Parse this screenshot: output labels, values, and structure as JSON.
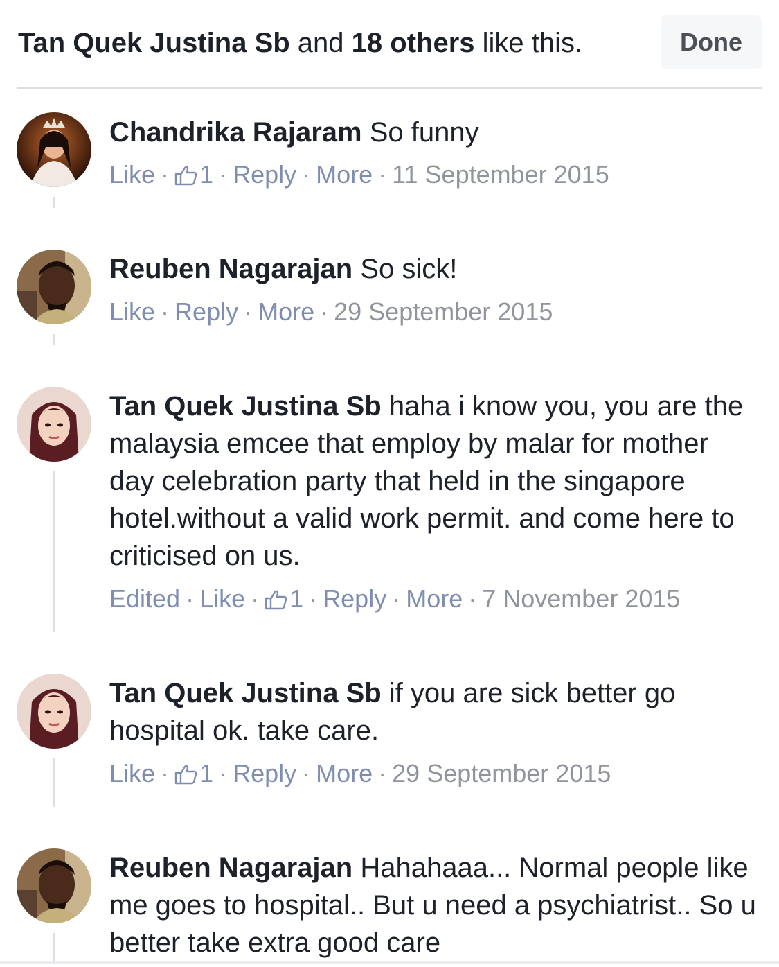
{
  "header": {
    "like_names": "Tan Quek Justina Sb",
    "like_and": " and ",
    "like_others": "18 others",
    "like_suffix": " like this.",
    "done_label": "Done"
  },
  "actions": {
    "like": "Like",
    "reply": "Reply",
    "more": "More",
    "edited": "Edited",
    "separator": "·"
  },
  "comments": [
    {
      "author": "Chandrika Rajaram",
      "text": "So funny",
      "reaction_count": "1",
      "date": "11 September 2015"
    },
    {
      "author": "Reuben Nagarajan",
      "text": "So sick!",
      "date": "29 September 2015"
    },
    {
      "author": "Tan Quek Justina Sb",
      "text": "haha i know you, you are the malaysia emcee that employ by malar for mother day celebration party that held in the singapore hotel.without a valid work permit. and come here to criticised on us.",
      "reaction_count": "1",
      "date": "7 November 2015"
    },
    {
      "author": "Tan Quek Justina Sb",
      "text": "if you are sick better go hospital ok. take care.",
      "reaction_count": "1",
      "date": "29 September 2015"
    },
    {
      "author": "Reuben Nagarajan",
      "text": "Hahahaaa... Normal people like me goes to hospital.. But u need a psychiatrist.. So u better take extra good care"
    }
  ],
  "colors": {
    "text": "#1d2129",
    "action_link": "#7f8db0",
    "meta_gray": "#90949c",
    "divider": "#dddfe2"
  }
}
